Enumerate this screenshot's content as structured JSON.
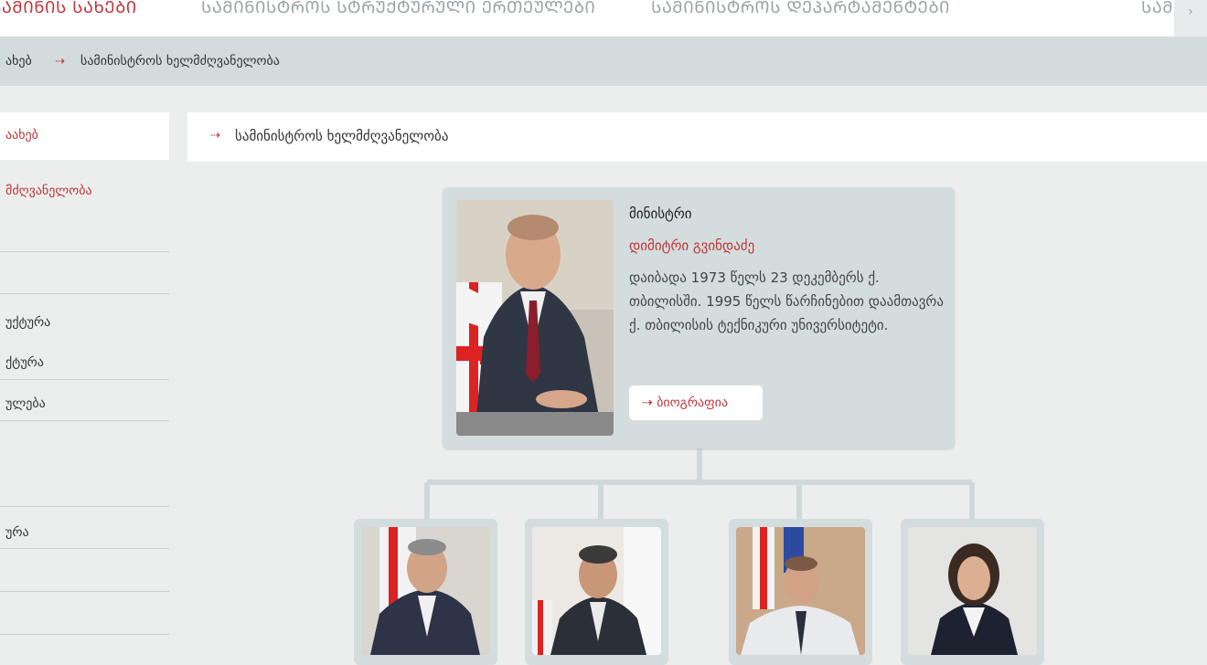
{
  "topnav": {
    "items": [
      "ᲡᲐᲛᲘᲜᲘᲡ ᲡᲐᲮᲔᲑᲘ",
      "ᲡᲐᲛᲘᲜᲘᲡᲢᲠᲝᲡ ᲡᲢᲠᲣᲥᲢᲣᲠᲣᲚᲘ ᲔᲠᲗᲔᲣᲚᲔᲑᲘ",
      "ᲡᲐᲛᲘᲜᲘᲡᲢᲠᲝᲡ ᲓᲔᲞᲐᲠᲢᲐᲛᲔᲜᲢᲔᲑᲘ",
      "ᲡᲐᲛ"
    ],
    "scroll_icon": "chevron-right-icon"
  },
  "breadcrumb": {
    "items": [
      "ახებ",
      "სამინისტროს ხელმძღვანელობა"
    ],
    "separator": "⇢"
  },
  "sidebar": {
    "header": "აახებ",
    "links": [
      {
        "label": "მძღვანელობა",
        "active": true
      },
      {
        "label": "უქტურა"
      },
      {
        "label": "ქტურა"
      },
      {
        "label": "ულება"
      },
      {
        "label": "ურა"
      }
    ]
  },
  "content": {
    "title": "სამინისტროს ხელმძღვანელობა",
    "arrow": "⇢"
  },
  "minister": {
    "role": "მინისტრი",
    "name": "დიმიტრი გვინდაძე",
    "bio": "დაიბადა 1973 წელს 23 დეკემბერს  ქ. თბილისში. 1995 წელს წარჩინებით დაამთავრა ქ. თბილისის ტექნიკური უნივერსიტეტი.",
    "button_label": "⇢ ბიოგრაფია"
  },
  "deputies": [
    {
      "photo": "deputy-1-photo"
    },
    {
      "photo": "deputy-2-photo"
    },
    {
      "photo": "deputy-3-photo"
    },
    {
      "photo": "deputy-4-photo"
    }
  ],
  "colors": {
    "accent": "#c0343a",
    "background": "#eceeee",
    "card": "#d4dddd",
    "breadcrumb_bg": "#d3dcdc"
  }
}
